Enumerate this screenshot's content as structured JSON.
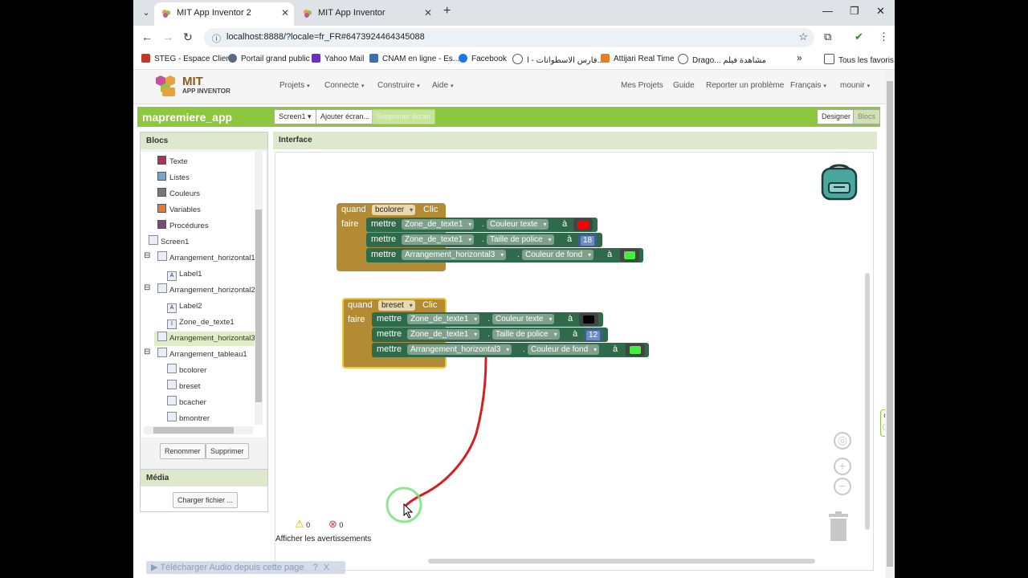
{
  "browser": {
    "tabs": [
      {
        "title": "MIT App Inventor 2",
        "active": true
      },
      {
        "title": "MIT App Inventor",
        "active": false
      }
    ],
    "url": "localhost:8888/?locale=fr_FR#6473924464345088",
    "bookmarks": [
      {
        "label": "STEG - Espace Client",
        "color": "#c0392b"
      },
      {
        "label": "Portail grand public",
        "color": "#5a6b80"
      },
      {
        "label": "Yahoo Mail",
        "color": "#6b2fbf"
      },
      {
        "label": "CNAM en ligne - Es...",
        "color": "#3a6fb0"
      },
      {
        "label": "Facebook",
        "color": "#1877f2"
      },
      {
        "label": "فارس الاسطوانات - ا...",
        "color": "#555555"
      },
      {
        "label": "Attijari Real Time",
        "color": "#e67e22"
      },
      {
        "label": "Drago... مشاهدة فيلم",
        "color": "#555555"
      }
    ],
    "bookmarks_more": "»",
    "all_bookmarks": "Tous les favoris"
  },
  "header": {
    "logo_title": "MIT",
    "logo_subtitle": "APP INVENTOR",
    "menus": [
      "Projets",
      "Connecte",
      "Construire",
      "Aide"
    ],
    "right_links": [
      "Mes Projets",
      "Guide",
      "Reporter un problème",
      "Français",
      "mounir"
    ]
  },
  "toolbar": {
    "project_name": "mapremiere_app",
    "screen": "Screen1",
    "add_screen": "Ajouter écran...",
    "remove_screen": "Supprimer écran",
    "designer": "Designer",
    "blocks": "Blocs"
  },
  "blocks_panel": {
    "title": "Blocs",
    "builtins": [
      {
        "label": "Texte",
        "color": "#b32d5e"
      },
      {
        "label": "Listes",
        "color": "#74a6d2"
      },
      {
        "label": "Couleurs",
        "color": "#777777"
      },
      {
        "label": "Variables",
        "color": "#e07b39"
      },
      {
        "label": "Procédures",
        "color": "#7a4a7e"
      }
    ],
    "components": [
      "Screen1",
      "Arrangement_horizontal1",
      "Label1",
      "Arrangement_horizontal2",
      "Label2",
      "Zone_de_texte1",
      "Arrangement_horizontal3",
      "Arrangement_tableau1",
      "bcolorer",
      "breset",
      "bcacher",
      "bmontrer"
    ],
    "rename": "Renommer",
    "delete": "Supprimer"
  },
  "media_panel": {
    "title": "Média",
    "upload": "Charger fichier ..."
  },
  "workspace": {
    "title": "Interface",
    "event1": {
      "when": "quand",
      "component": "bcolorer",
      "event": "Clic",
      "do": "faire",
      "rows": [
        {
          "set": "mettre",
          "comp": "Zone_de_texte1",
          "prop": "Couleur texte",
          "to": "à",
          "kind": "color",
          "value": "#ff0000"
        },
        {
          "set": "mettre",
          "comp": "Zone_de_texte1",
          "prop": "Taille de police",
          "to": "à",
          "kind": "number",
          "value": "18"
        },
        {
          "set": "mettre",
          "comp": "Arrangement_horizontal3",
          "prop": "Couleur de fond",
          "to": "à",
          "kind": "color",
          "value": "#44ee44"
        }
      ]
    },
    "event2": {
      "when": "quand",
      "component": "breset",
      "event": "Clic",
      "do": "faire",
      "rows": [
        {
          "set": "mettre",
          "comp": "Zone_de_texte1",
          "prop": "Couleur texte",
          "to": "à",
          "kind": "color",
          "value": "#000000"
        },
        {
          "set": "mettre",
          "comp": "Zone_de_texte1",
          "prop": "Taille de police",
          "to": "à",
          "kind": "number",
          "value": "12"
        },
        {
          "set": "mettre",
          "comp": "Arrangement_horizontal3",
          "prop": "Couleur de fond",
          "to": "à",
          "kind": "color",
          "value": "#44ee44"
        }
      ]
    },
    "warnings_count": "0",
    "errors_count": "0",
    "show_warnings": "Afficher les avertissements"
  },
  "overlay": {
    "audio_download": "Télécharger Audio depuis cette page"
  }
}
